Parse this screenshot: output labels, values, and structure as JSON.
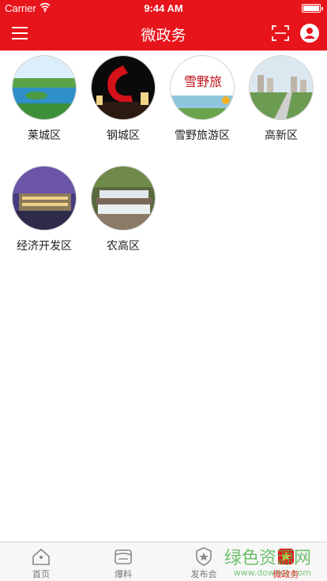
{
  "status_bar": {
    "carrier": "Carrier",
    "time": "9:44 AM"
  },
  "header": {
    "title": "微政务",
    "icons": [
      "menu-icon",
      "scan-icon",
      "user-icon"
    ]
  },
  "districts": [
    {
      "label": "莱城区"
    },
    {
      "label": "钢城区"
    },
    {
      "label": "雪野旅游区",
      "image_text": "雪野旅"
    },
    {
      "label": "高新区"
    },
    {
      "label": "经济开发区"
    },
    {
      "label": "农高区"
    }
  ],
  "tabs": [
    {
      "label": "首页",
      "icon": "home-icon"
    },
    {
      "label": "爆料",
      "icon": "news-icon"
    },
    {
      "label": "发布会",
      "icon": "badge-icon"
    },
    {
      "label": "微政务",
      "icon": "star-icon",
      "active": true
    }
  ],
  "watermark": {
    "title": "绿色资源网",
    "url": "www.downcc.com"
  },
  "colors": {
    "brand_red": "#e8141b",
    "tab_active": "#e8141b",
    "watermark_green": "#4bb34b"
  }
}
